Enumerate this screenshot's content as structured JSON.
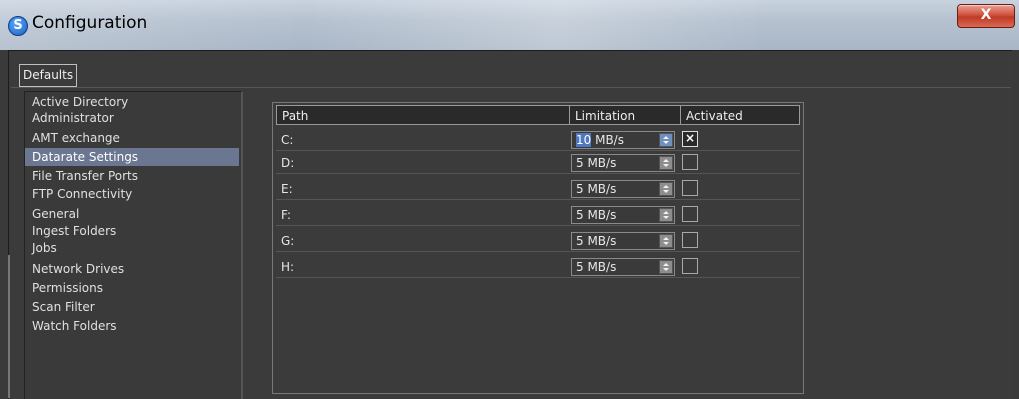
{
  "window": {
    "title": "Configuration",
    "close_label": "X",
    "icon_glyph": "S"
  },
  "tabs": [
    {
      "label": "Defaults",
      "active": true
    }
  ],
  "sidebar": {
    "items": [
      {
        "label": "Active Directory"
      },
      {
        "label": "Administrator"
      },
      {
        "label": "AMT exchange"
      },
      {
        "label": "Datarate Settings",
        "selected": true
      },
      {
        "label": "File Transfer Ports"
      },
      {
        "label": "FTP Connectivity"
      },
      {
        "label": "General"
      },
      {
        "label": "Ingest Folders"
      },
      {
        "label": "Jobs"
      },
      {
        "label": "Network Drives"
      },
      {
        "label": "Permissions"
      },
      {
        "label": "Scan Filter"
      },
      {
        "label": "Watch Folders"
      }
    ]
  },
  "grid": {
    "columns": [
      {
        "label": "Path"
      },
      {
        "label": "Limitation"
      },
      {
        "label": "Activated"
      }
    ],
    "rows": [
      {
        "path": "C:",
        "limit_num": "10",
        "limit_unit": " MB/s",
        "activated": true,
        "check": "×"
      },
      {
        "path": "D:",
        "limit_num": "5",
        "limit_unit": " MB/s",
        "activated": false,
        "check": ""
      },
      {
        "path": "E:",
        "limit_num": "5",
        "limit_unit": " MB/s",
        "activated": false,
        "check": ""
      },
      {
        "path": "F:",
        "limit_num": "5",
        "limit_unit": " MB/s",
        "activated": false,
        "check": ""
      },
      {
        "path": "G:",
        "limit_num": "5",
        "limit_unit": " MB/s",
        "activated": false,
        "check": ""
      },
      {
        "path": "H:",
        "limit_num": "5",
        "limit_unit": " MB/s",
        "activated": false,
        "check": ""
      }
    ]
  },
  "colors": {
    "background": "#3b3b3b",
    "selection": "#6b7690",
    "title_bar": "#b6c2d0",
    "close_button": "#c9432f"
  }
}
